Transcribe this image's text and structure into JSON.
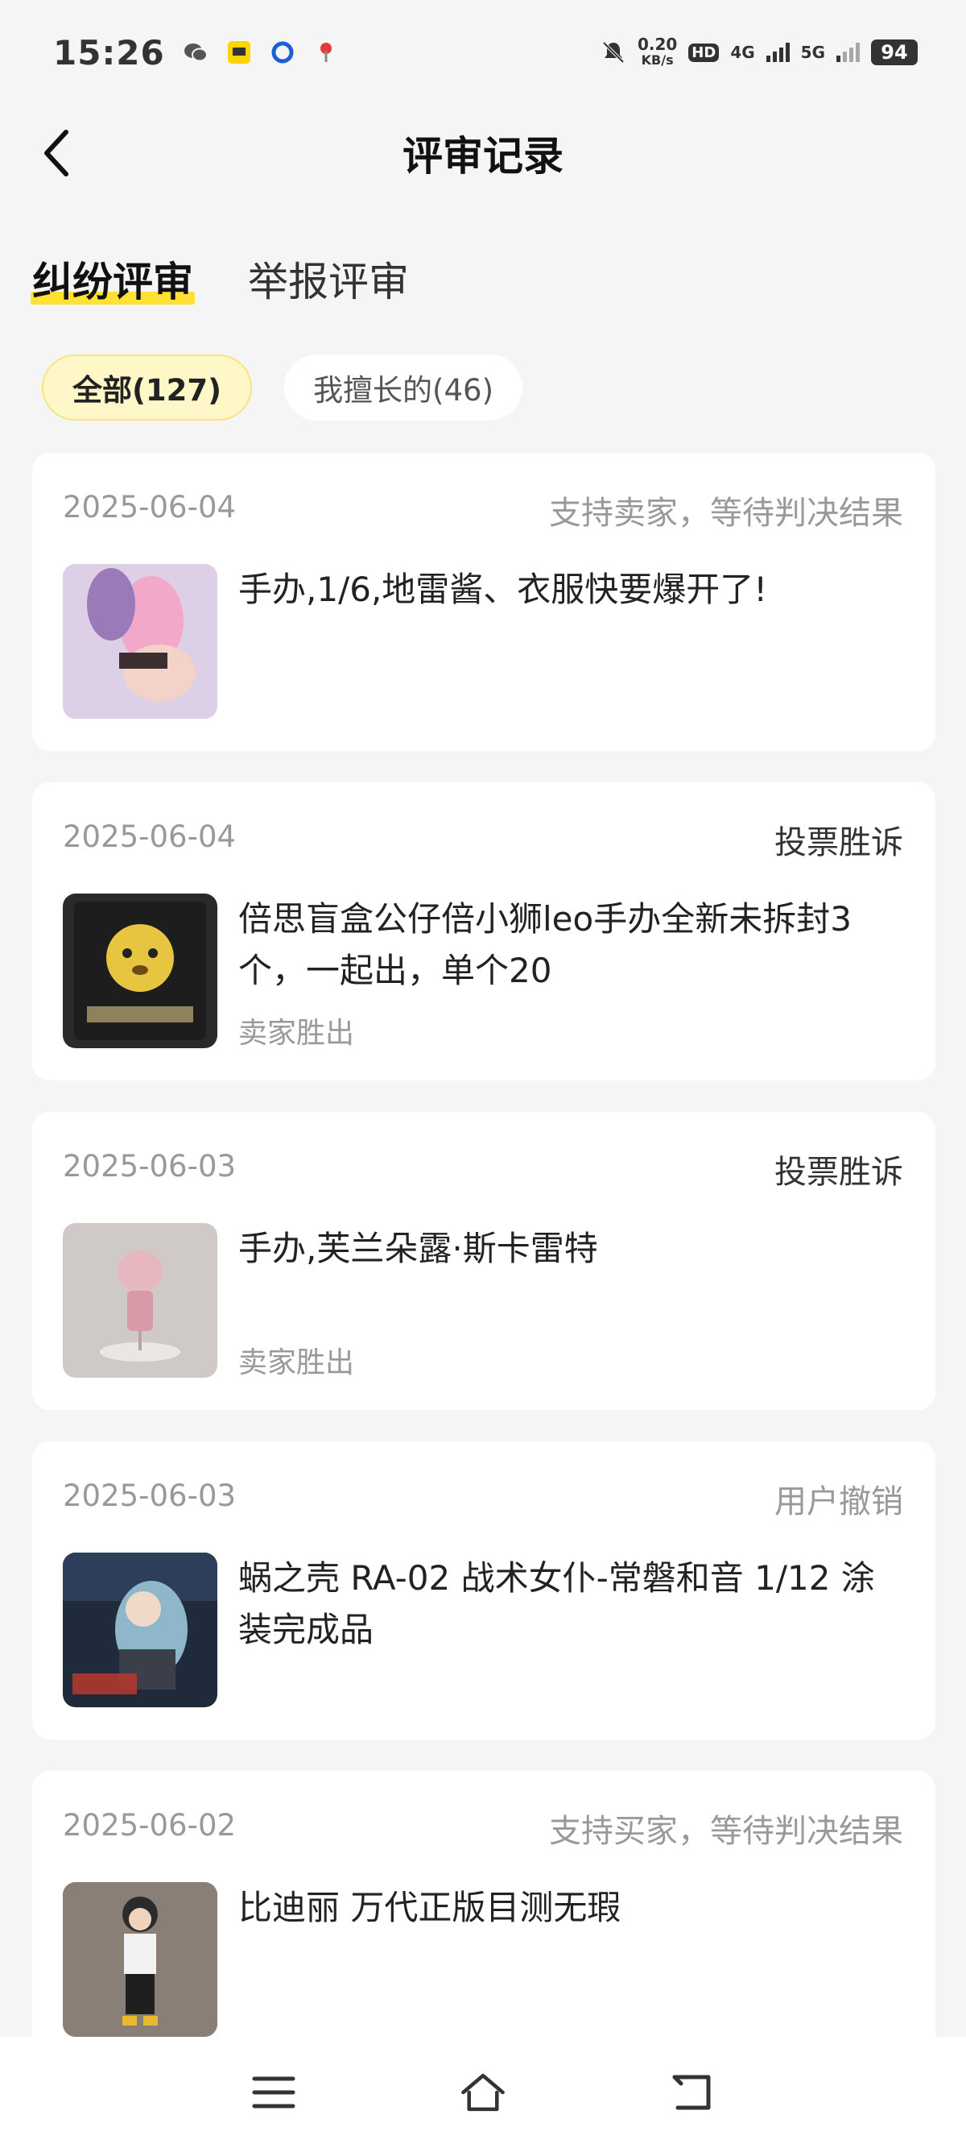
{
  "status_bar": {
    "time": "15:26",
    "net_speed_value": "0.20",
    "net_speed_unit": "KB/s",
    "hd": "HD",
    "sig1": "4G",
    "sig2": "5G",
    "battery": "94",
    "icons": [
      "wechat-icon",
      "app-icon",
      "circle-app-icon",
      "location-icon",
      "mute-icon"
    ]
  },
  "header": {
    "title": "评审记录"
  },
  "tabs": [
    {
      "label": "纠纷评审",
      "active": true
    },
    {
      "label": "举报评审",
      "active": false
    }
  ],
  "filters": [
    {
      "label": "全部(127)",
      "active": true
    },
    {
      "label": "我擅长的(46)",
      "active": false
    }
  ],
  "records": [
    {
      "date": "2025-06-04",
      "status": "支持卖家，等待判决结果",
      "title": "手办,1/6,地雷酱、衣服快要爆开了!",
      "sub": ""
    },
    {
      "date": "2025-06-04",
      "status": "投票胜诉",
      "title": "倍思盲盒公仔倍小狮leo手办全新未拆封3个，一起出，单个20",
      "sub": "卖家胜出"
    },
    {
      "date": "2025-06-03",
      "status": "投票胜诉",
      "title": "手办,芙兰朵露·斯卡雷特",
      "sub": "卖家胜出"
    },
    {
      "date": "2025-06-03",
      "status": "用户撤销",
      "title": "蜗之壳 RA-02 战术女仆-常磐和音 1/12 涂装完成品",
      "sub": ""
    },
    {
      "date": "2025-06-02",
      "status": "支持买家，等待判决结果",
      "title": "比迪丽 万代正版目测无瑕",
      "sub": ""
    }
  ],
  "colors": {
    "accent": "#ffe033",
    "chip_active_bg": "#fff7c8",
    "background": "#f5f5f5"
  }
}
